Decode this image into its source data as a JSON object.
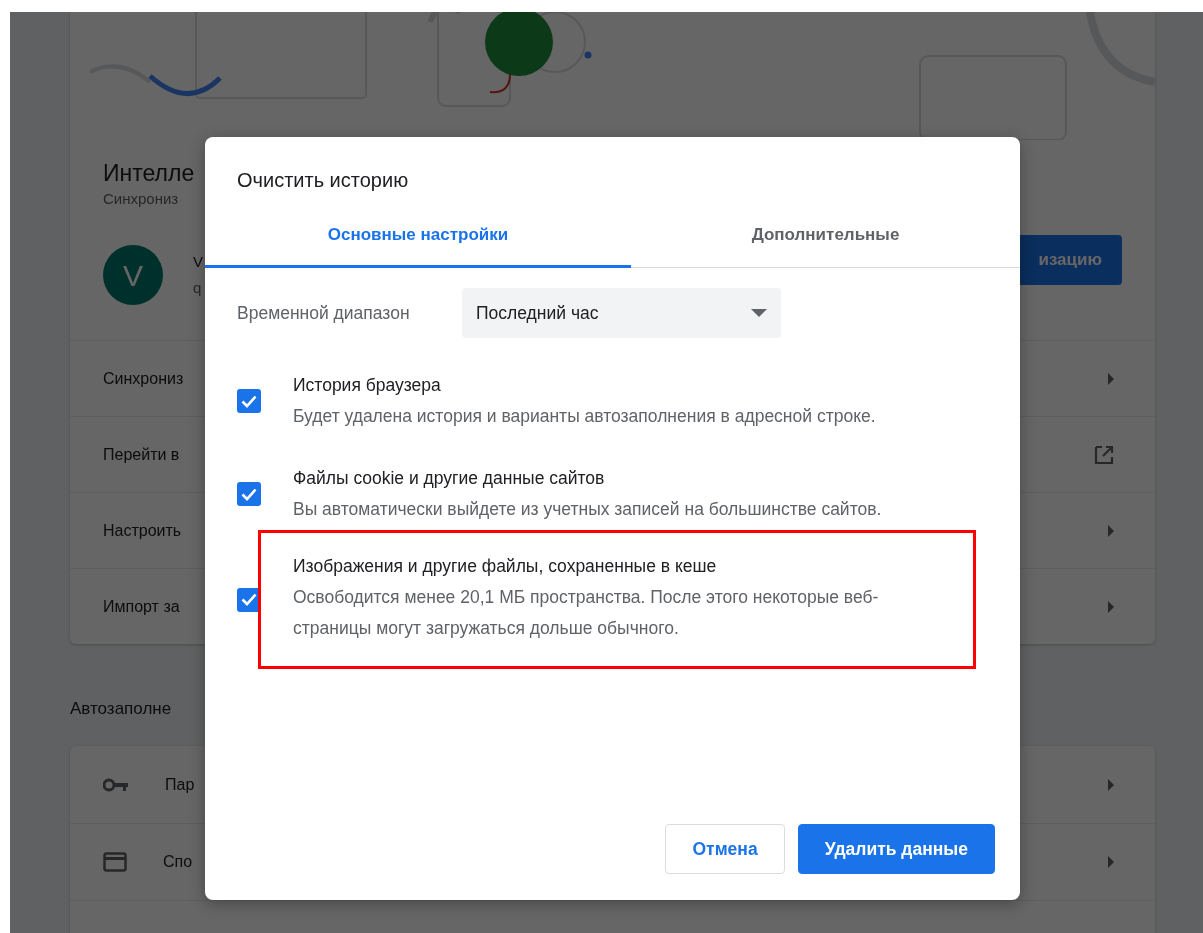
{
  "background": {
    "card_title": "Интелле",
    "card_subtitle": "Синхрониз",
    "avatar_letter": "V",
    "account_name": "V",
    "account_email": "q",
    "sync_button": "изацию",
    "rows": [
      {
        "label": "Синхрониз",
        "kind": "arrow"
      },
      {
        "label": "Перейти в",
        "kind": "external"
      },
      {
        "label": "Настроить",
        "kind": "arrow"
      },
      {
        "label": "Импорт за",
        "kind": "arrow"
      }
    ],
    "section_title": "Автозаполне",
    "autofill_rows": [
      {
        "label": "Пар",
        "kind": "key"
      },
      {
        "label": "Спо",
        "kind": "card"
      }
    ]
  },
  "dialog": {
    "title": "Очистить историю",
    "tabs": [
      {
        "label": "Основные настройки",
        "selected": true
      },
      {
        "label": "Дополнительные",
        "selected": false
      }
    ],
    "time_range": {
      "label": "Временной диапазон",
      "value": "Последний час"
    },
    "items": [
      {
        "title": "История браузера",
        "description": "Будет удалена история и варианты автозаполнения в адресной строке.",
        "checked": true,
        "highlighted": false
      },
      {
        "title": "Файлы cookie и другие данные сайтов",
        "description": "Вы автоматически выйдете из учетных записей на большинстве сайтов.",
        "checked": true,
        "highlighted": false
      },
      {
        "title": "Изображения и другие файлы, сохраненные в кеше",
        "description": "Освободится менее 20,1 МБ пространства. После этого некоторые веб-страницы могут загружаться дольше обычного.",
        "checked": true,
        "highlighted": true
      }
    ],
    "buttons": [
      {
        "label": "Отмена",
        "kind": "secondary"
      },
      {
        "label": "Удалить данные",
        "kind": "primary"
      }
    ]
  }
}
